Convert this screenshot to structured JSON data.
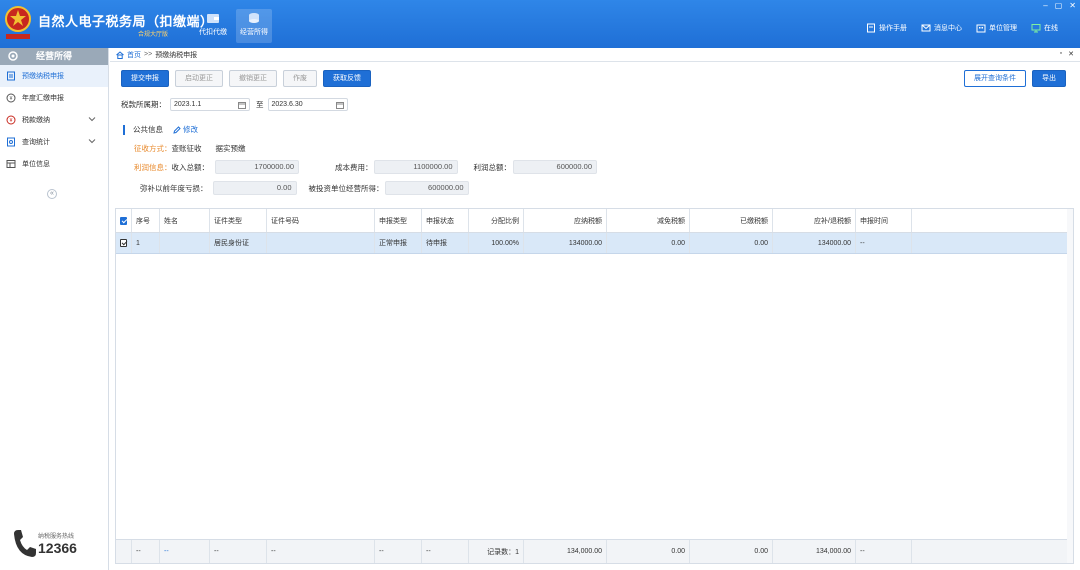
{
  "app": {
    "title": "自然人电子税务局（扣缴端）",
    "subtitle": "合规大厅版",
    "nav": [
      {
        "label": "代扣代缴",
        "icon": "wallet-icon"
      },
      {
        "label": "经营所得",
        "icon": "coins-icon"
      }
    ],
    "links": [
      {
        "label": "操作手册",
        "icon": "manual-icon"
      },
      {
        "label": "消息中心",
        "icon": "message-icon"
      },
      {
        "label": "单位管理",
        "icon": "building-icon"
      },
      {
        "label": "在线",
        "icon": "online-icon"
      }
    ],
    "window_controls": [
      "–",
      "▢",
      "✕"
    ]
  },
  "sidebar": {
    "header": "经营所得",
    "items": [
      {
        "label": "预缴纳税申报",
        "icon": "declare-icon",
        "active": true
      },
      {
        "label": "年度汇缴申报",
        "icon": "annual-icon"
      },
      {
        "label": "税款缴纳",
        "icon": "pay-icon",
        "expandable": true
      },
      {
        "label": "查询统计",
        "icon": "query-icon",
        "expandable": true
      },
      {
        "label": "单位信息",
        "icon": "org-icon"
      }
    ],
    "collapse": "«",
    "hotline": {
      "label": "纳税服务热线",
      "number": "12366"
    }
  },
  "breadcrumb": {
    "home": "首页",
    "sep": ">>",
    "current": "预缴纳税申报"
  },
  "tab_controls": [
    "▫",
    "✕"
  ],
  "toolbar": {
    "buttons": [
      "提交申报",
      "启动更正",
      "撤销更正",
      "作废",
      "获取反馈"
    ],
    "right": [
      "展开查询条件",
      "导出"
    ]
  },
  "period": {
    "label": "税款所属期：",
    "from": "2023.1.1",
    "to_label": "至",
    "to": "2023.6.30"
  },
  "public_info": {
    "title": "公共信息",
    "edit": "修改",
    "method_label": "征收方式：",
    "method_value": "查账征收",
    "method_detail": "据实预缴",
    "profit_label": "利润信息：",
    "income_label": "收入总额：",
    "income": "1700000.00",
    "cost_label": "成本费用：",
    "cost": "1100000.00",
    "profit_total_label": "利润总额：",
    "profit_total": "600000.00",
    "loss_label": "弥补以前年度亏损：",
    "loss": "0.00",
    "invest_label": "被投资单位经营所得：",
    "invest": "600000.00"
  },
  "table": {
    "columns": [
      "序号",
      "姓名",
      "证件类型",
      "证件号码",
      "申报类型",
      "申报状态",
      "分配比例",
      "应纳税额",
      "减免税额",
      "已缴税额",
      "应补/退税额",
      "申报时间"
    ],
    "rows": [
      [
        "1",
        "",
        "居民身份证",
        "",
        "正常申报",
        "待申报",
        "100.00%",
        "134000.00",
        "0.00",
        "0.00",
        "134000.00",
        "--"
      ]
    ],
    "footer": [
      "--",
      "--",
      "--",
      "--",
      "--",
      "--",
      "记录数：1",
      "134,000.00",
      "0.00",
      "0.00",
      "134,000.00",
      "--"
    ]
  }
}
